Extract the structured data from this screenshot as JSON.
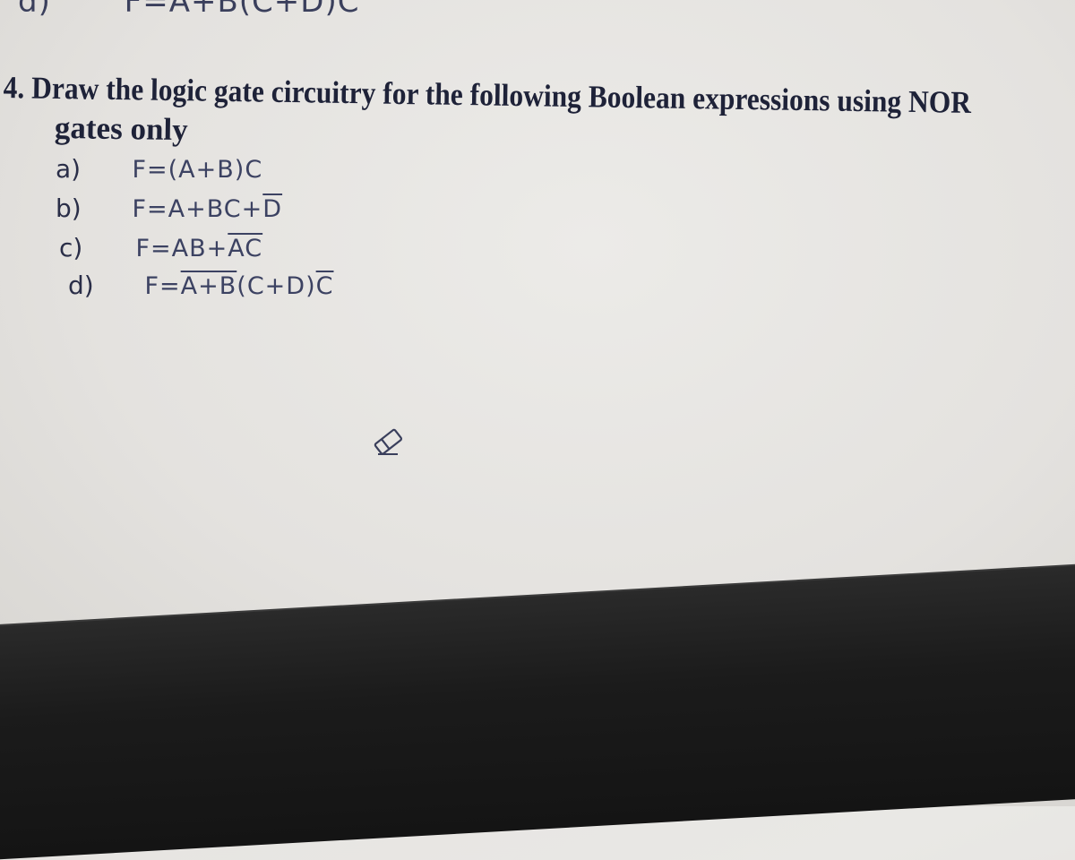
{
  "top_partial": {
    "label": "d)",
    "expression": "F=A+B(C+D)C"
  },
  "question": {
    "number": "4.",
    "text": "Draw the logic gate circuitry for the following Boolean expressions using NOR",
    "continuation": "gates only"
  },
  "items": [
    {
      "label": "a)",
      "parts": [
        {
          "t": "F=(A+B)C",
          "over": false
        }
      ]
    },
    {
      "label": "b)",
      "parts": [
        {
          "t": "F=A+BC+",
          "over": false
        },
        {
          "t": "D",
          "over": true
        }
      ]
    },
    {
      "label": "c)",
      "parts": [
        {
          "t": "F=AB+",
          "over": false
        },
        {
          "t": "AC",
          "over": true
        }
      ]
    },
    {
      "label": "d)",
      "parts": [
        {
          "t": "F=",
          "over": false
        },
        {
          "t": "A+B",
          "over": true
        },
        {
          "t": "(C+D)",
          "over": false
        },
        {
          "t": "C",
          "over": true
        }
      ]
    }
  ],
  "icons": {
    "eraser": "eraser-icon"
  }
}
